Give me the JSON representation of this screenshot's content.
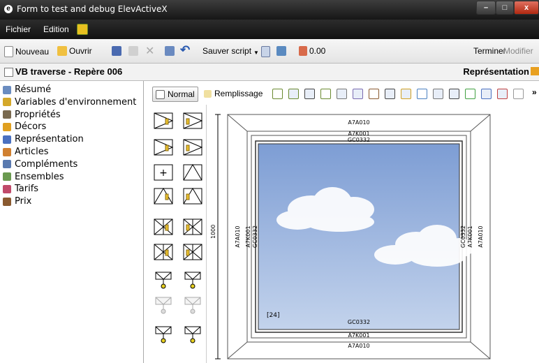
{
  "window": {
    "title": "Form to test and debug ElevActiveX",
    "minimize": "–",
    "maximize": "□",
    "close": "x"
  },
  "menu": {
    "items": [
      "Fichier",
      "Edition"
    ]
  },
  "toolbar": {
    "nouveau": "Nouveau",
    "ouvrir": "Ouvrir",
    "sauver_script": "Sauver script",
    "value": "0.00",
    "terminer": "Terminer",
    "modifier": "Modifier"
  },
  "header": {
    "title": "VB traverse - Repère 006",
    "right": "Représentation"
  },
  "tree": {
    "items": [
      {
        "label": "Résumé",
        "icon": "document-icon",
        "color": "#6a8cc0"
      },
      {
        "label": "Variables d'environnement",
        "icon": "variables-icon",
        "color": "#d4a82a"
      },
      {
        "label": "Propriétés",
        "icon": "properties-icon",
        "color": "#7a6a50"
      },
      {
        "label": "Décors",
        "icon": "decors-icon",
        "color": "#e0a020"
      },
      {
        "label": "Représentation",
        "icon": "representation-icon",
        "color": "#4a70c0"
      },
      {
        "label": "Articles",
        "icon": "articles-icon",
        "color": "#d08030"
      },
      {
        "label": "Compléments",
        "icon": "complements-icon",
        "color": "#5a7ab0"
      },
      {
        "label": "Ensembles",
        "icon": "ensembles-icon",
        "color": "#6a9a50"
      },
      {
        "label": "Tarifs",
        "icon": "tarifs-icon",
        "color": "#c04a6a"
      },
      {
        "label": "Prix",
        "icon": "prix-icon",
        "color": "#8a5a30"
      }
    ]
  },
  "view_tabs": {
    "normal": "Normal",
    "remplissage": "Remplissage",
    "more": "»"
  },
  "drawing": {
    "labels_top": [
      "A7A010",
      "A7K001",
      "GC0332"
    ],
    "labels_bottom": [
      "GC0332",
      "A7K001",
      "A7A010"
    ],
    "left_labels": [
      "A7A010",
      "A7K001",
      "GC0332"
    ],
    "right_labels": [
      "GC0332",
      "A7K001",
      "A7A010"
    ],
    "dimension": "1000",
    "tag": "[24]"
  },
  "colors": {
    "sky_top": "#7d9dd4",
    "sky_bottom": "#c3d3ec"
  }
}
